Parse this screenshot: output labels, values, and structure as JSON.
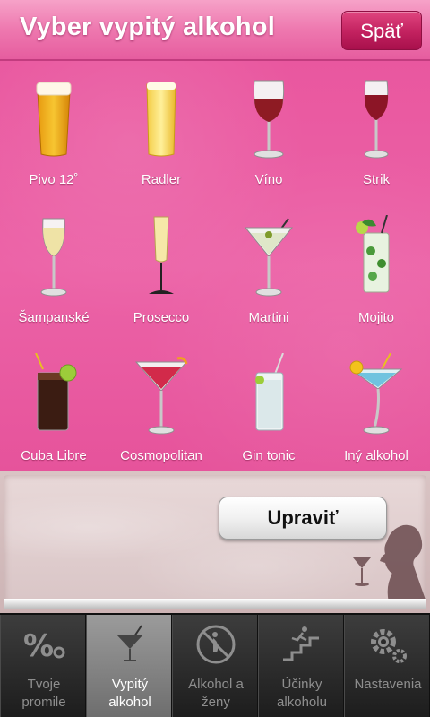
{
  "header": {
    "title": "Vyber vypitý alkohol",
    "back_label": "Späť"
  },
  "drinks": [
    {
      "label": "Pivo 12˚",
      "icon": "beer-glass-icon"
    },
    {
      "label": "Radler",
      "icon": "radler-glass-icon"
    },
    {
      "label": "Víno",
      "icon": "wine-glass-icon"
    },
    {
      "label": "Strik",
      "icon": "strik-glass-icon"
    },
    {
      "label": "Šampanské",
      "icon": "champagne-glass-icon"
    },
    {
      "label": "Prosecco",
      "icon": "prosecco-glass-icon"
    },
    {
      "label": "Martini",
      "icon": "martini-glass-icon"
    },
    {
      "label": "Mojito",
      "icon": "mojito-glass-icon"
    },
    {
      "label": "Cuba Libre",
      "icon": "cuba-libre-glass-icon"
    },
    {
      "label": "Cosmopolitan",
      "icon": "cosmopolitan-glass-icon"
    },
    {
      "label": "Gin tonic",
      "icon": "gin-tonic-glass-icon"
    },
    {
      "label": "Iný alkohol",
      "icon": "other-alcohol-glass-icon"
    }
  ],
  "panel": {
    "edit_label": "Upraviť"
  },
  "tabs": [
    {
      "line1": "Tvoje",
      "line2": "promile",
      "icon": "percent-icon",
      "active": false
    },
    {
      "line1": "Vypitý",
      "line2": "alkohol",
      "icon": "cocktail-icon",
      "active": true
    },
    {
      "line1": "Alkohol a",
      "line2": "ženy",
      "icon": "pregnant-woman-icon",
      "active": false
    },
    {
      "line1": "Účinky",
      "line2": "alkoholu",
      "icon": "falling-person-icon",
      "active": false
    },
    {
      "line1": "",
      "line2": "Nastavenia",
      "icon": "gear-icon",
      "active": false
    }
  ],
  "colors": {
    "accent": "#e8539d",
    "header": "#ee78af",
    "back_button": "#c2215f",
    "tab_active": "#8a8a8a"
  }
}
